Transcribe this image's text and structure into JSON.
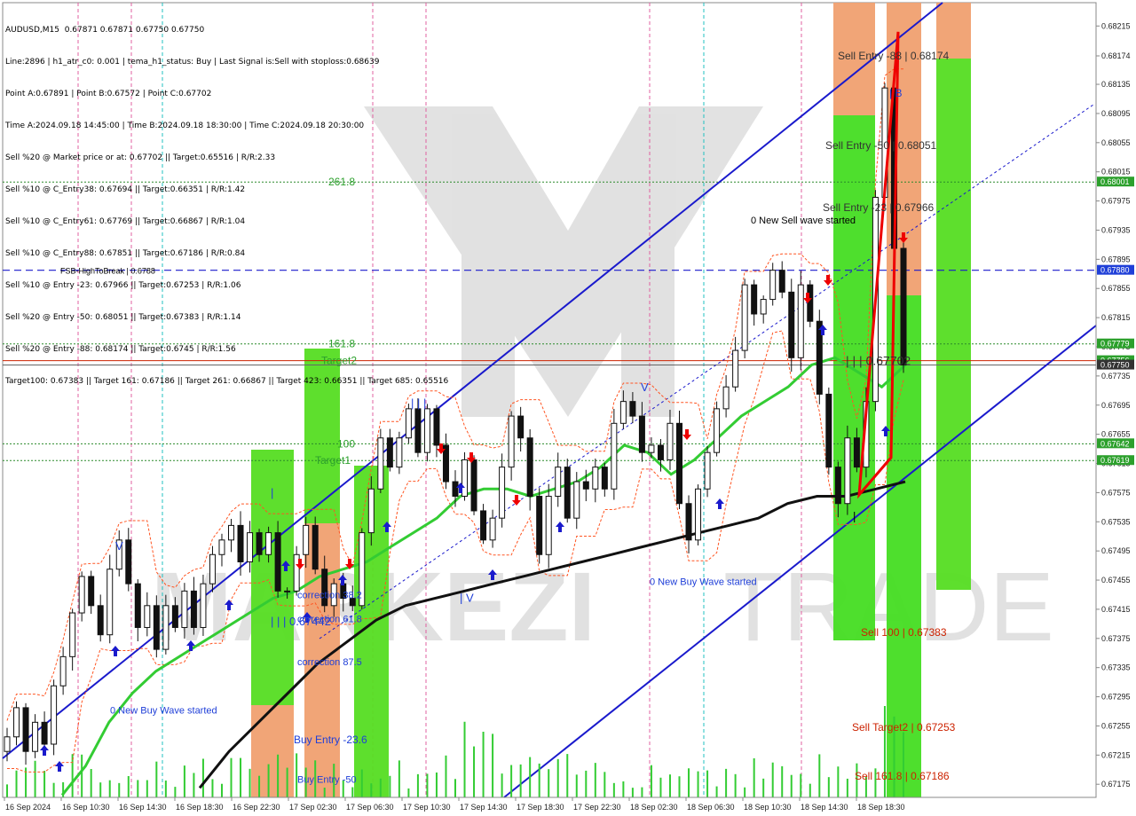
{
  "header": {
    "symbol": "AUDUSD,M15",
    "ohlc": "0.67871 0.67871 0.67750 0.67750",
    "lines": [
      "Line:2896 | h1_atr_c0: 0.001 | tema_h1_status: Buy | Last Signal is:Sell with stoploss:0.68639",
      "Point A:0.67891 | Point B:0.67572 | Point C:0.67702",
      "Time A:2024.09.18 14:45:00 | Time B:2024.09.18 18:30:00 | Time C:2024.09.18 20:30:00",
      "Sell %20 @ Market price or at: 0.67702 || Target:0.65516 | R/R:2.33",
      "Sell %10 @ C_Entry38: 0.67694 || Target:0.66351 | R/R:1.42",
      "Sell %10 @ C_Entry61: 0.67769 || Target:0.66867 | R/R:1.04",
      "Sell %10 @ C_Entry88: 0.67851 || Target:0.67186 | R/R:0.84",
      "Sell %10 @ Entry -23: 0.67966 || Target:0.67253 | R/R:1.06",
      "Sell %20 @ Entry -50: 0.68051 || Target:0.67383 | R/R:1.14",
      "Sell %20 @ Entry -88: 0.68174 || Target:0.6745 | R/R:1.56",
      "Target100: 0.67383 || Target 161: 0.67186 || Target 261: 0.66867 || Target 423: 0.66351 || Target 685: 0.65516"
    ]
  },
  "chart_data": {
    "type": "candlestick",
    "symbol": "AUDUSD",
    "timeframe": "M15",
    "ylim": [
      0.67157,
      0.68247
    ],
    "price_ticks": [
      "0.68215",
      "0.68174",
      "0.68135",
      "0.68095",
      "0.68055",
      "0.68015",
      "0.67975",
      "0.67935",
      "0.67895",
      "0.67855",
      "0.67815",
      "0.67775",
      "0.67735",
      "0.67695",
      "0.67655",
      "0.67615",
      "0.67575",
      "0.67535",
      "0.67495",
      "0.67455",
      "0.67415",
      "0.67375",
      "0.67335",
      "0.67295",
      "0.67255",
      "0.67215",
      "0.67175"
    ],
    "time_ticks": [
      "16 Sep 2024",
      "16 Sep 10:30",
      "16 Sep 14:30",
      "16 Sep 18:30",
      "16 Sep 22:30",
      "17 Sep 02:30",
      "17 Sep 06:30",
      "17 Sep 10:30",
      "17 Sep 14:30",
      "17 Sep 18:30",
      "17 Sep 22:30",
      "18 Sep 02:30",
      "18 Sep 06:30",
      "18 Sep 10:30",
      "18 Sep 14:30",
      "18 Sep 18:30"
    ],
    "price_badges": [
      {
        "label": "0.68001",
        "price": 0.68001,
        "color": "#2ca02c"
      },
      {
        "label": "0.67880",
        "price": 0.6788,
        "color": "#1f3fd8"
      },
      {
        "label": "0.67779",
        "price": 0.67779,
        "color": "#2ca02c"
      },
      {
        "label": "0.67756",
        "price": 0.67756,
        "color": "#2ca02c"
      },
      {
        "label": "0.67750",
        "price": 0.6775,
        "color": "#333333"
      },
      {
        "label": "0.67642",
        "price": 0.67642,
        "color": "#2ca02c"
      },
      {
        "label": "0.67619",
        "price": 0.67619,
        "color": "#2ca02c"
      }
    ],
    "chart_labels": [
      {
        "text": "261.8",
        "price": 0.68001,
        "color": "#2ca02c"
      },
      {
        "text": "FSB-HighToBreak | 0.6788",
        "price": 0.6788,
        "color": "#000000"
      },
      {
        "text": "161.8",
        "price": 0.67779,
        "color": "#2ca02c"
      },
      {
        "text": "Target2",
        "price": 0.67756,
        "color": "#2ca02c"
      },
      {
        "text": "100",
        "price": 0.67642,
        "color": "#2ca02c"
      },
      {
        "text": "Target1",
        "price": 0.67619,
        "color": "#2ca02c"
      },
      {
        "text": "Sell Entry -88 | 0.68174",
        "price": 0.68174,
        "color": "#333333"
      },
      {
        "text": "Sell Entry -50 | 0.68051",
        "price": 0.68051,
        "color": "#333333"
      },
      {
        "text": "Sell Entry -23 | 0.67966",
        "price": 0.67966,
        "color": "#333333"
      },
      {
        "text": "0 New Sell wave started",
        "price": 0.67949,
        "color": "#000000"
      },
      {
        "text": "| | | 0.67702",
        "price": 0.67755,
        "color": "#333333"
      },
      {
        "text": "Sell 100 | 0.67383",
        "price": 0.67383,
        "color": "#cc2200"
      },
      {
        "text": "Sell Target2 | 0.67253",
        "price": 0.67253,
        "color": "#cc2200"
      },
      {
        "text": "Sell 161.8 | 0.67186",
        "price": 0.67186,
        "color": "#cc2200"
      },
      {
        "text": "0 New Buy Wave started",
        "price": 0.67453,
        "color": "#1f3fd8"
      },
      {
        "text": "0 New Buy Wave started",
        "price": 0.67277,
        "color": "#1f3fd8"
      },
      {
        "text": "correction 38.2",
        "price": 0.67435,
        "color": "#1f3fd8"
      },
      {
        "text": "correction 61.8",
        "price": 0.67402,
        "color": "#1f3fd8"
      },
      {
        "text": "| | | 0.67442",
        "price": 0.67398,
        "color": "#1f3fd8"
      },
      {
        "text": "correction 87.5",
        "price": 0.67343,
        "color": "#1f3fd8"
      },
      {
        "text": "Buy Entry -23.6",
        "price": 0.67236,
        "color": "#1f3fd8"
      },
      {
        "text": "Buy Entry -50",
        "price": 0.67182,
        "color": "#1f3fd8"
      },
      {
        "text": "V",
        "price": 0.67501,
        "color": "#1f3fd8"
      },
      {
        "text": "| | |",
        "price": 0.67697,
        "color": "#1f3fd8"
      },
      {
        "text": "V",
        "price": 0.67719,
        "color": "#1f3fd8"
      },
      {
        "text": "| V",
        "price": 0.6743,
        "color": "#1f3fd8"
      },
      {
        "text": "|",
        "price": 0.67574,
        "color": "#1f3fd8"
      },
      {
        "text": "| B",
        "price": 0.68123,
        "color": "#1f3fd8"
      },
      {
        "text": "|",
        "price": 0.67542,
        "color": "#000000"
      }
    ],
    "close_series": [
      0.6724,
      0.6728,
      0.6722,
      0.6726,
      0.6723,
      0.6731,
      0.6735,
      0.6741,
      0.6746,
      0.6742,
      0.6738,
      0.6747,
      0.6751,
      0.6745,
      0.6739,
      0.6742,
      0.6736,
      0.6742,
      0.6739,
      0.6744,
      0.6739,
      0.6745,
      0.6749,
      0.6751,
      0.6753,
      0.6748,
      0.6752,
      0.6749,
      0.6752,
      0.6744,
      0.6744,
      0.6749,
      0.6753,
      0.6747,
      0.6742,
      0.6745,
      0.6743,
      0.6742,
      0.6752,
      0.6758,
      0.6765,
      0.6761,
      0.6765,
      0.6769,
      0.6763,
      0.6769,
      0.6764,
      0.6759,
      0.6757,
      0.6762,
      0.6755,
      0.6751,
      0.6754,
      0.6761,
      0.6768,
      0.6765,
      0.6757,
      0.6749,
      0.6757,
      0.6761,
      0.6754,
      0.6759,
      0.6758,
      0.6761,
      0.6758,
      0.6767,
      0.677,
      0.6768,
      0.6763,
      0.6764,
      0.6762,
      0.6767,
      0.6756,
      0.6751,
      0.6758,
      0.6763,
      0.6769,
      0.6772,
      0.6777,
      0.6786,
      0.6782,
      0.6784,
      0.6788,
      0.6785,
      0.6776,
      0.6786,
      0.6781,
      0.6771,
      0.6761,
      0.6756,
      0.6765,
      0.6761,
      0.677,
      0.6798,
      0.6813,
      0.6791,
      0.6775
    ],
    "ma_series": [
      {
        "name": "green",
        "color": "#33cc33",
        "values": [
          0.6716,
          0.672,
          0.6726,
          0.673,
          0.6733,
          0.6735,
          0.6737,
          0.6739,
          0.6741,
          0.6743,
          0.6744,
          0.6746,
          0.6747,
          0.6748,
          0.675,
          0.6752,
          0.6754,
          0.6757,
          0.6758,
          0.6758,
          0.6757,
          0.6758,
          0.6759,
          0.6761,
          0.6764,
          0.6763,
          0.676,
          0.6762,
          0.6765,
          0.6768,
          0.677,
          0.6772,
          0.6775,
          0.6776,
          0.6774,
          0.6772,
          0.6775
        ]
      },
      {
        "name": "black",
        "color": "#111111",
        "values": [
          0.6717,
          0.6722,
          0.6726,
          0.673,
          0.6734,
          0.6737,
          0.674,
          0.6742,
          0.6743,
          0.6744,
          0.6745,
          0.6746,
          0.6747,
          0.6748,
          0.6749,
          0.675,
          0.6751,
          0.6752,
          0.6753,
          0.6754,
          0.6756,
          0.6757,
          0.6757,
          0.6758,
          0.6759
        ]
      }
    ],
    "sell_entry": {
      "a": 0.67572,
      "b": 0.68207,
      "c": 0.67623
    }
  }
}
